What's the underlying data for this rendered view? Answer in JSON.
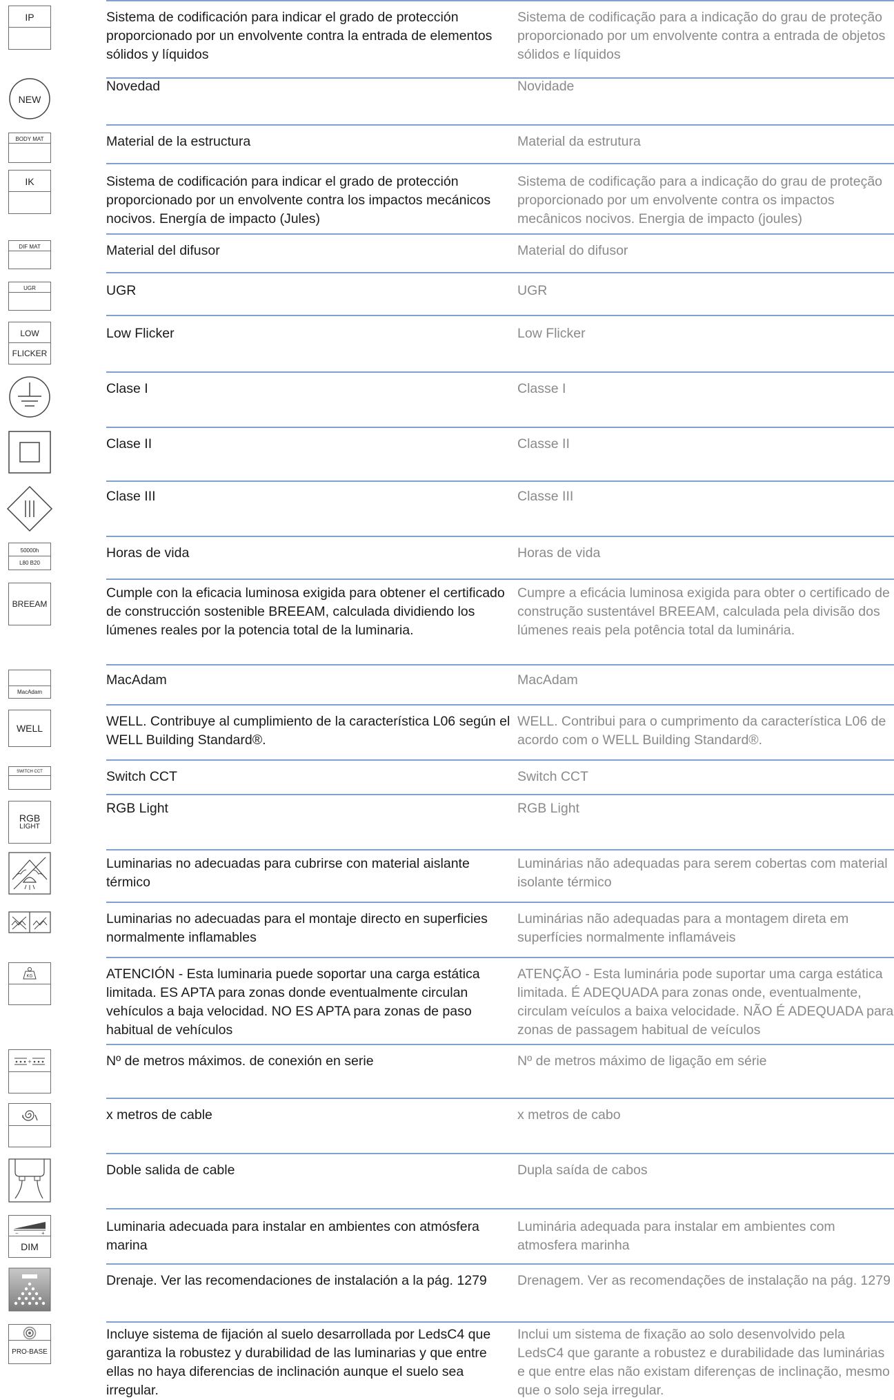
{
  "rows": [
    {
      "icon": "ip-icon",
      "icon_label": "IP",
      "es": "Sistema de codificación para indicar el grado de protección proporcionado por un envolvente contra la entrada de elementos sólidos y líquidos",
      "pt": "Sistema de codificação para a indicação do grau de proteção proporcionado por um envolvente contra a entrada de objetos sólidos e líquidos"
    },
    {
      "icon": "new-icon",
      "icon_label": "NEW",
      "es": "Novedad",
      "pt": "Novidade"
    },
    {
      "icon": "body-mat-icon",
      "icon_label": "BODY MAT",
      "es": "Material de la estructura",
      "pt": "Material da estrutura"
    },
    {
      "icon": "ik-icon",
      "icon_label": "IK",
      "es": "Sistema de codificación para indicar el grado de protección proporcionado por un envolvente contra los impactos mecánicos nocivos. Energía de impacto (Jules)",
      "pt": "Sistema de codificação para a indicação do grau de proteção proporcionado por um envolvente contra os impactos mecânicos nocivos. Energia de impacto (joules)"
    },
    {
      "icon": "dif-mat-icon",
      "icon_label": "DIF MAT",
      "es": "Material del difusor",
      "pt": "Material do difusor"
    },
    {
      "icon": "ugr-icon",
      "icon_label": "UGR",
      "es": "UGR",
      "pt": "UGR"
    },
    {
      "icon": "low-flicker-icon",
      "icon_label_top": "LOW",
      "icon_label_bottom": "FLICKER",
      "es": "Low Flicker",
      "pt": "Low Flicker"
    },
    {
      "icon": "class-i-earth-icon",
      "es": "Clase I",
      "pt": "Classe I"
    },
    {
      "icon": "class-ii-double-square-icon",
      "es": "Clase II",
      "pt": "Classe II"
    },
    {
      "icon": "class-iii-diamond-icon",
      "es": "Clase III",
      "pt": "Classe III"
    },
    {
      "icon": "lifetime-hours-icon",
      "icon_label_top": "50000h",
      "icon_label_bottom": "L80 B20",
      "es": "Horas de vida",
      "pt": "Horas de vida"
    },
    {
      "icon": "breeam-icon",
      "icon_label": "BREEAM",
      "es": "Cumple con la eficacia luminosa exigida para obtener el certificado de construcción sostenible BREEAM, calculada dividiendo los lúmenes reales por la potencia total de la luminaria.",
      "pt": "Cumpre a eficácia luminosa exigida para obter o certificado de construção sustentável BREEAM, calculada pela divisão dos lúmenes reais pela potência total da luminária."
    },
    {
      "icon": "macadam-icon",
      "icon_label": "MacAdam",
      "es": "MacAdam",
      "pt": "MacAdam"
    },
    {
      "icon": "well-icon",
      "icon_label": "WELL",
      "es": "WELL. Contribuye al cumplimiento de la característica L06 según el WELL Building Standard®.",
      "pt": "WELL. Contribui para o cumprimento da característica L06 de acordo com o WELL Building Standard®."
    },
    {
      "icon": "switch-cct-icon",
      "icon_label": "SWITCH CCT",
      "es": "Switch CCT",
      "pt": "Switch CCT"
    },
    {
      "icon": "rgb-light-icon",
      "icon_label_top": "RGB",
      "icon_label_bottom": "LIGHT",
      "es": "RGB Light",
      "pt": "RGB Light"
    },
    {
      "icon": "no-insulation-cover-icon",
      "es": "Luminarias no adecuadas para cubrirse con material aislante térmico",
      "pt": "Luminárias não adequadas para serem cobertas com material isolante térmico"
    },
    {
      "icon": "no-flammable-surface-icon",
      "es": "Luminarias no adecuadas para el montaje directo en superficies normalmente inflamables",
      "pt": "Luminárias não adequadas para a montagem direta em superfícies normalmente inflamáveis"
    },
    {
      "icon": "weight-load-icon",
      "icon_label": "KG",
      "es": "ATENCIÓN - Esta luminaria puede soportar una carga estática limitada. ES APTA para zonas donde eventualmente circulan vehículos a baja velocidad. NO ES APTA para zonas de paso habitual de vehículos",
      "pt": "ATENÇÃO - Esta luminária pode suportar uma carga estática limitada. É ADEQUADA para zonas onde, eventualmente, circulam veículos a baixa velocidade. NÃO É ADEQUADA para zonas de passagem habitual de veículos"
    },
    {
      "icon": "series-connection-icon",
      "es": "Nº de metros máximos. de conexión en serie",
      "pt": "Nº de metros máximo de ligação em série"
    },
    {
      "icon": "cable-coil-icon",
      "es": "x metros de cable",
      "pt": "x metros de cabo"
    },
    {
      "icon": "double-cable-outlet-icon",
      "es": "Doble salida de cable",
      "pt": "Dupla saída de cabos"
    },
    {
      "icon": "dim-icon",
      "icon_label": "DIM",
      "es": "Luminaria adecuada para instalar en ambientes con atmósfera marina",
      "pt": "Luminária adequada para instalar em ambientes com atmosfera marinha"
    },
    {
      "icon": "drainage-icon",
      "es": "Drenaje. Ver las recomendaciones de instalación a la pág. 1279",
      "pt": "Drenagem. Ver as recomendações de instalação na pág. 1279"
    },
    {
      "icon": "pro-base-icon",
      "icon_label": "PRO-BASE",
      "es": "Incluye sistema de fijación al suelo desarrollada por LedsC4 que garantiza la robustez y durabilidad de las luminarias y que entre ellas no haya diferencias de inclinación aunque el suelo sea irregular.",
      "pt": "Inclui um sistema de fixação ao solo desenvolvido pela LedsC4 que garante a robustez e durabilidade das luminárias e que entre elas não existam diferenças de inclinação, mesmo que o solo seja irregular."
    }
  ]
}
